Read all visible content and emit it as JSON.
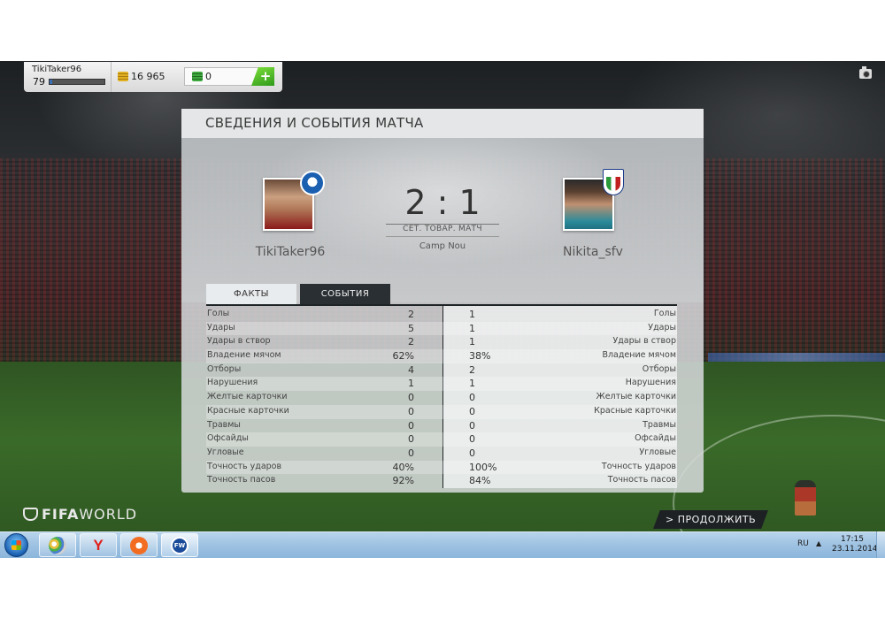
{
  "account": {
    "name": "TikiTaker96",
    "level": "79",
    "xp_progress": 0.05,
    "coins": "16 965",
    "points": "0",
    "add_points_label": "+"
  },
  "panel": {
    "title": "СВЕДЕНИЯ И СОБЫТИЯ МАТЧА"
  },
  "match": {
    "home_player": "TikiTaker96",
    "away_player": "Nikita_sfv",
    "score": "2 : 1",
    "match_type": "СЕТ. ТОВАР. МАТЧ",
    "venue": "Camp Nou"
  },
  "tabs": [
    {
      "label": "ФАКТЫ",
      "active": true
    },
    {
      "label": "СОБЫТИЯ",
      "active": false
    }
  ],
  "stats": [
    {
      "label": "Голы",
      "home": "2",
      "away": "1"
    },
    {
      "label": "Удары",
      "home": "5",
      "away": "1"
    },
    {
      "label": "Удары в створ",
      "home": "2",
      "away": "1"
    },
    {
      "label": "Владение мячом",
      "home": "62%",
      "away": "38%"
    },
    {
      "label": "Отборы",
      "home": "4",
      "away": "2"
    },
    {
      "label": "Нарушения",
      "home": "1",
      "away": "1"
    },
    {
      "label": "Желтые карточки",
      "home": "0",
      "away": "0"
    },
    {
      "label": "Красные карточки",
      "home": "0",
      "away": "0"
    },
    {
      "label": "Травмы",
      "home": "0",
      "away": "0"
    },
    {
      "label": "Офсайды",
      "home": "0",
      "away": "0"
    },
    {
      "label": "Угловые",
      "home": "0",
      "away": "0"
    },
    {
      "label": "Точность ударов",
      "home": "40%",
      "away": "100%"
    },
    {
      "label": "Точность пасов",
      "home": "92%",
      "away": "84%"
    }
  ],
  "footer": {
    "logo_bold": "FIFA",
    "logo_thin": "WORLD",
    "continue_label": "> ПРОДОЛЖИТЬ"
  },
  "taskbar": {
    "icons": [
      "start-orb-icon",
      "paint-icon",
      "yandex-browser-icon",
      "origin-icon",
      "fifa-world-icon"
    ],
    "fifa_icon_text": "FW",
    "yandex_icon_text": "Y",
    "language": "RU",
    "tray_arrow": "▲",
    "time": "17:15",
    "date": "23.11.2014"
  },
  "colors": {
    "accent_green": "#4fc22a",
    "panel_dark": "#1e2326"
  }
}
